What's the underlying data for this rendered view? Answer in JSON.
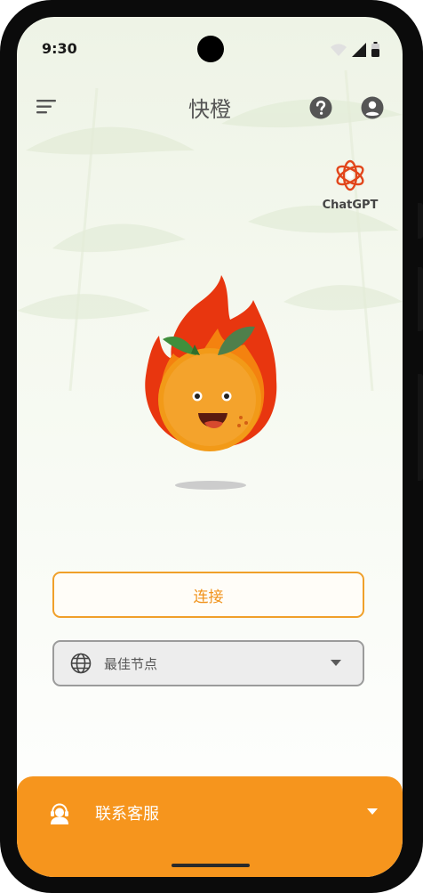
{
  "status_bar": {
    "time": "9:30"
  },
  "app_bar": {
    "title": "快橙"
  },
  "chatgpt": {
    "label": "ChatGPT"
  },
  "main": {
    "connect_label": "连接",
    "node_select": {
      "selected": "最佳节点"
    }
  },
  "support_bar": {
    "label": "联系客服"
  },
  "icons": {
    "menu": "menu-icon",
    "help": "help-icon",
    "account": "account-icon",
    "chatgpt": "openai-logo-icon",
    "globe": "globe-icon",
    "support": "customer-service-icon",
    "dropdown": "chevron-down-icon"
  },
  "colors": {
    "accent": "#f6951d",
    "connect_border": "#f0a02a",
    "chatgpt_logo": "#e2461b",
    "flame": "#e8360f"
  }
}
